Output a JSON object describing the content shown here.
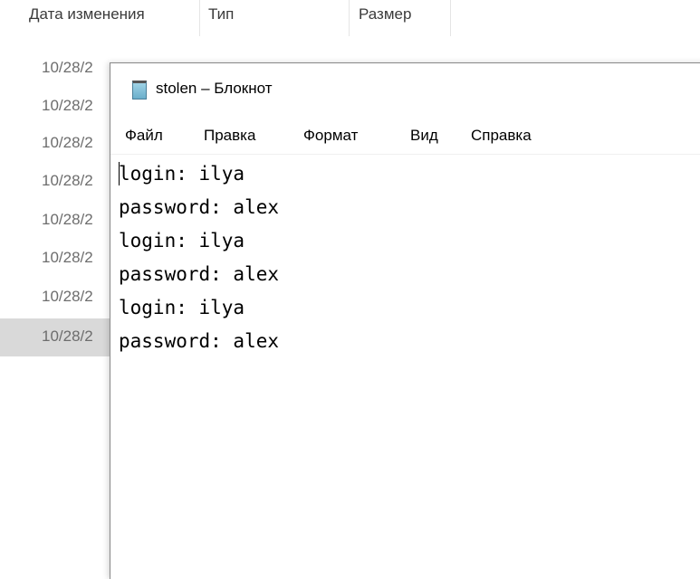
{
  "explorer": {
    "columns": [
      "Дата изменения",
      "Тип",
      "Размер"
    ],
    "rows": [
      "10/28/2",
      "10/28/2",
      "10/28/2",
      "10/28/2",
      "10/28/2",
      "10/28/2",
      "10/28/2",
      "10/28/2"
    ]
  },
  "notepad": {
    "title": "stolen – Блокнот",
    "menu": [
      "Файл",
      "Правка",
      "Формат",
      "Вид",
      "Справка"
    ],
    "lines": [
      "login: ilya",
      "password: alex",
      "login: ilya",
      "password: alex",
      "login: ilya",
      "password: alex"
    ]
  }
}
